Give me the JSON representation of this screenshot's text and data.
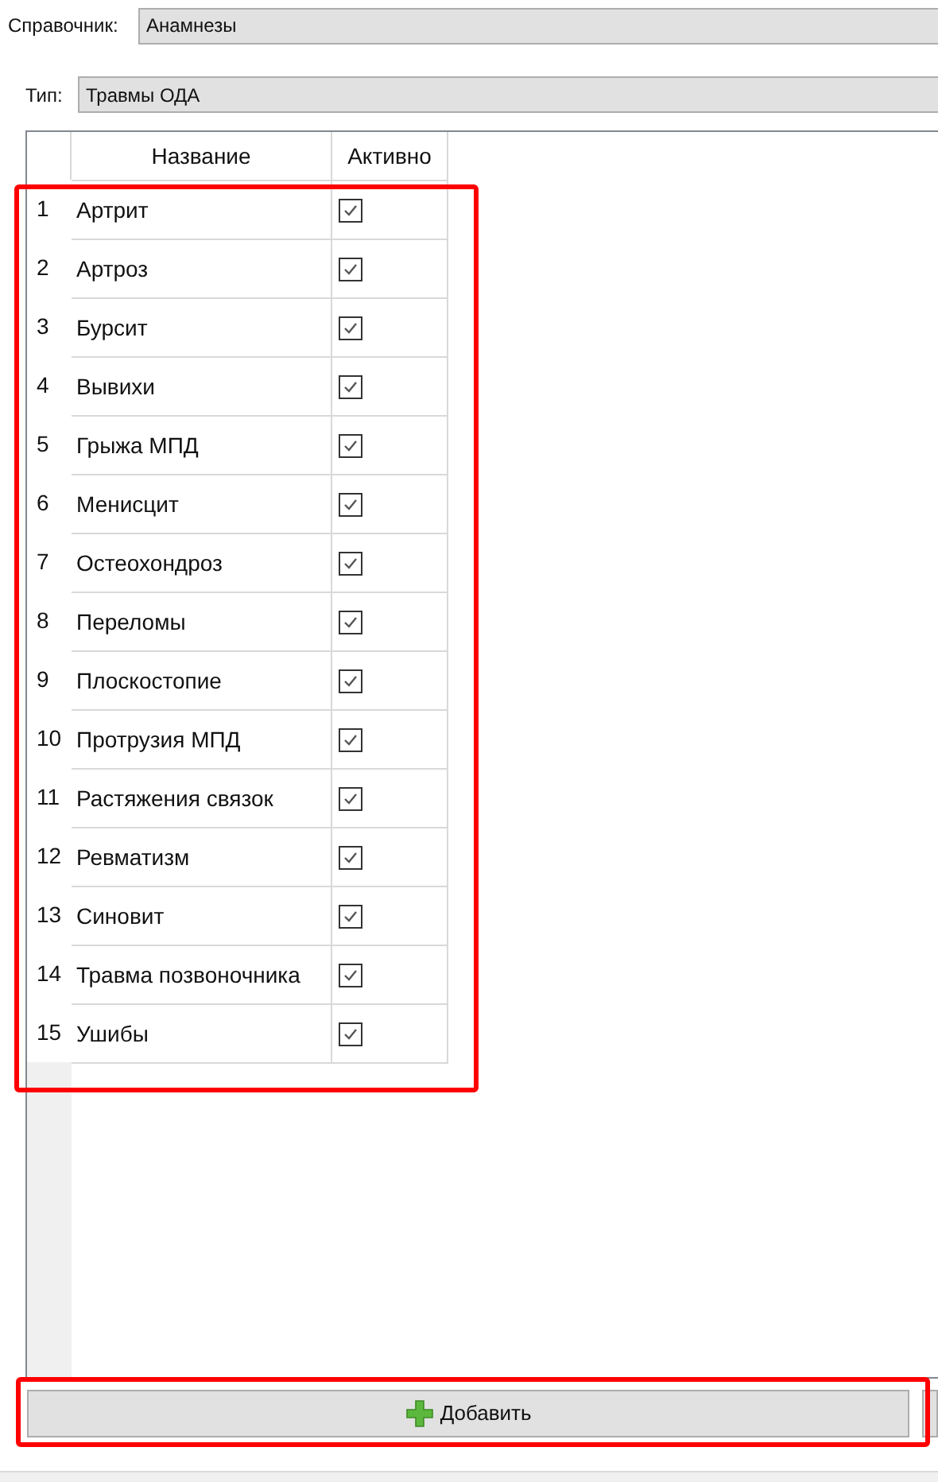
{
  "directory": {
    "label": "Справочник:",
    "value": "Анамнезы"
  },
  "type": {
    "label": "Тип:",
    "value": "Травмы ОДА"
  },
  "table": {
    "columns": [
      "Название",
      "Активно"
    ],
    "rows": [
      {
        "number": "1",
        "name": "Артрит",
        "active": true
      },
      {
        "number": "2",
        "name": "Артроз",
        "active": true
      },
      {
        "number": "3",
        "name": "Бурсит",
        "active": true
      },
      {
        "number": "4",
        "name": "Вывихи",
        "active": true
      },
      {
        "number": "5",
        "name": "Грыжа МПД",
        "active": true
      },
      {
        "number": "6",
        "name": "Менисцит",
        "active": true
      },
      {
        "number": "7",
        "name": "Остеохондроз",
        "active": true
      },
      {
        "number": "8",
        "name": "Переломы",
        "active": true
      },
      {
        "number": "9",
        "name": "Плоскостопие",
        "active": true
      },
      {
        "number": "10",
        "name": "Протрузия МПД",
        "active": true
      },
      {
        "number": "11",
        "name": "Растяжения связок",
        "active": true
      },
      {
        "number": "12",
        "name": "Ревматизм",
        "active": true
      },
      {
        "number": "13",
        "name": "Синовит",
        "active": true
      },
      {
        "number": "14",
        "name": "Травма позвоночника",
        "active": true
      },
      {
        "number": "15",
        "name": "Ушибы",
        "active": true
      }
    ]
  },
  "add_button": {
    "label": "Добавить"
  }
}
